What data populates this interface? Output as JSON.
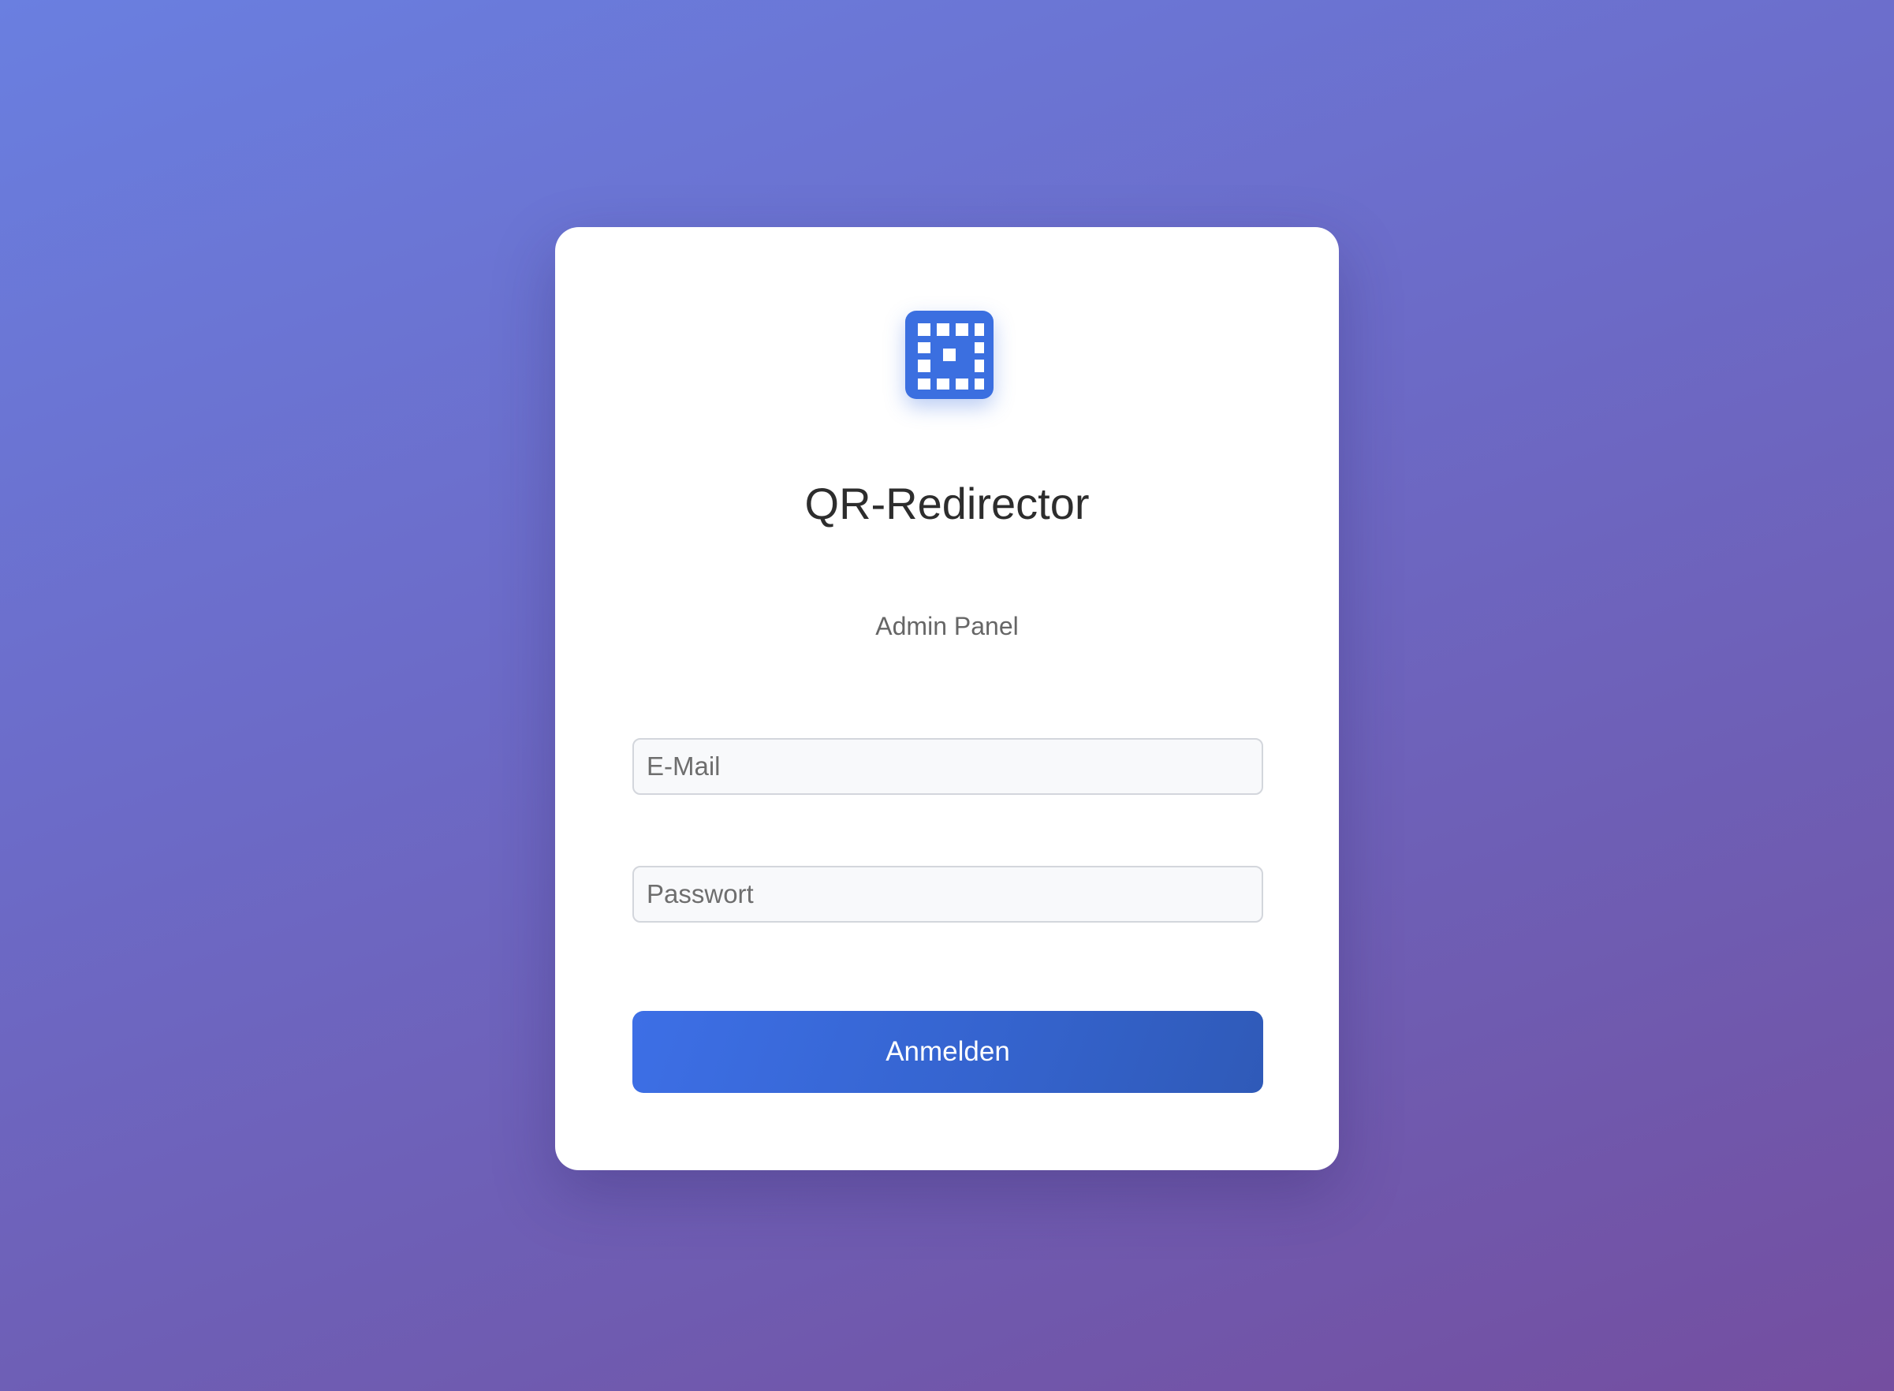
{
  "app": {
    "title": "QR-Redirector",
    "subtitle": "Admin Panel",
    "logo_icon": "qr-code-icon"
  },
  "form": {
    "email_placeholder": "E-Mail",
    "email_value": "",
    "password_placeholder": "Passwort",
    "password_value": "",
    "submit_label": "Anmelden"
  },
  "colors": {
    "accent": "#3b6fe0",
    "background_start": "#6a7fe0",
    "background_end": "#744ea0"
  }
}
